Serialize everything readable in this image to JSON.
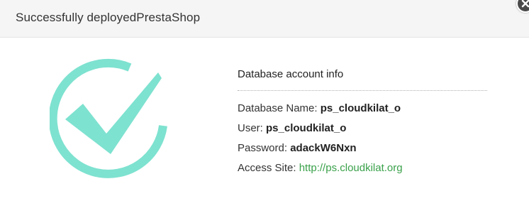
{
  "dialog": {
    "title": "Successfully deployedPrestaShop",
    "close_icon": "close-icon"
  },
  "status_icon": {
    "name": "checkmark-circle-icon",
    "color": "#7ee2d0"
  },
  "info": {
    "heading": "Database account info",
    "rows": [
      {
        "label": "Database Name:",
        "value": "ps_cloudkilat_o"
      },
      {
        "label": "User:",
        "value": "ps_cloudkilat_o"
      },
      {
        "label": "Password:",
        "value": "adackW6Nxn"
      },
      {
        "label": "Access Site:",
        "value": "http://ps.cloudkilat.org",
        "link_color": "#3aa14a"
      }
    ]
  }
}
